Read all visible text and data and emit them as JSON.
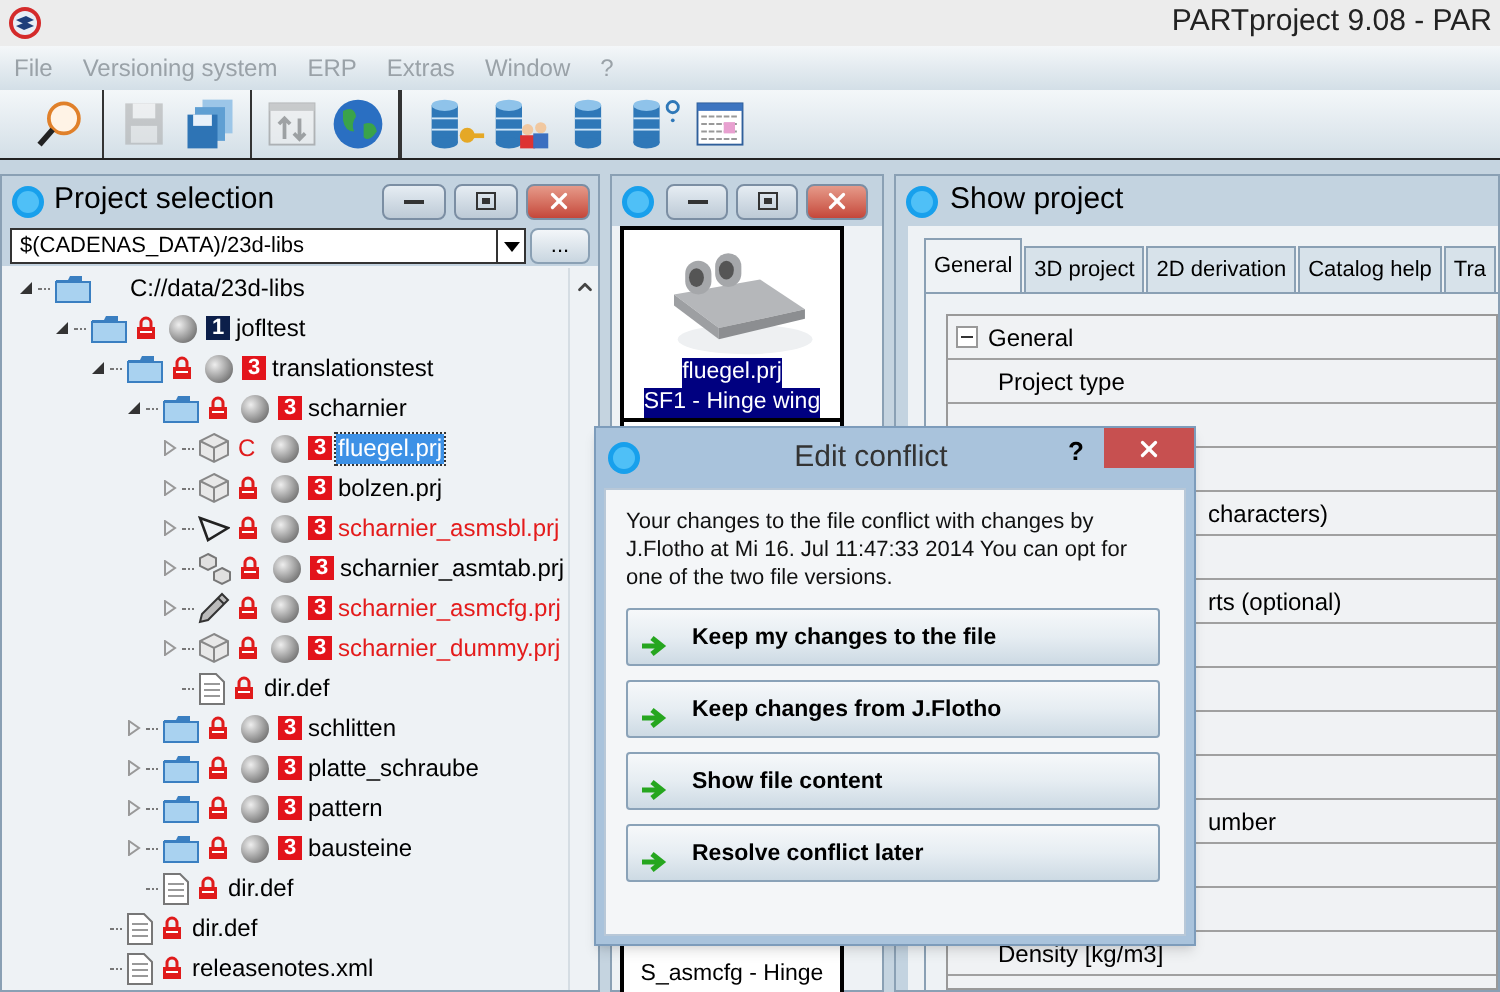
{
  "window": {
    "title": "PARTproject 9.08 - PAR"
  },
  "menu": [
    {
      "label": "File",
      "disabled": true
    },
    {
      "label": "Versioning system",
      "disabled": true
    },
    {
      "label": "ERP",
      "disabled": true
    },
    {
      "label": "Extras",
      "disabled": true
    },
    {
      "label": "Window",
      "disabled": true
    },
    {
      "label": "?",
      "disabled": true
    }
  ],
  "toolbar": {
    "groups": [
      [
        {
          "kind": "magnifier",
          "disabled": false
        }
      ],
      [
        {
          "kind": "save",
          "disabled": true
        },
        {
          "kind": "save-all",
          "disabled": false
        }
      ],
      [
        {
          "kind": "convert",
          "disabled": true
        },
        {
          "kind": "globe",
          "disabled": false
        }
      ],
      [
        {
          "kind": "db-key",
          "disabled": false
        },
        {
          "kind": "db-users",
          "disabled": false
        },
        {
          "kind": "db",
          "disabled": false
        },
        {
          "kind": "db-help",
          "disabled": false
        },
        {
          "kind": "table",
          "disabled": false
        }
      ]
    ]
  },
  "project_selection": {
    "title": "Project selection",
    "path": "$(CADENAS_DATA)/23d-libs",
    "browse_label": "...",
    "tree": [
      {
        "name": "C://data/23d-libs",
        "kind": "folder",
        "expanded": true,
        "selected": false,
        "modified": false,
        "children": [
          {
            "name": "jofltest",
            "kind": "folder",
            "expanded": true,
            "locked": true,
            "badge": "1",
            "color": "#0c1f4a",
            "selected": false,
            "modified": false,
            "children": [
              {
                "name": "translationstest",
                "kind": "folder",
                "expanded": true,
                "locked": true,
                "badge": "3",
                "color": "#e3141b",
                "selected": false,
                "modified": false,
                "children": [
                  {
                    "name": "scharnier",
                    "kind": "folder",
                    "expanded": true,
                    "locked": true,
                    "badge": "3",
                    "color": "#e3141b",
                    "selected": false,
                    "modified": false,
                    "children": [
                      {
                        "name": "fluegel.prj",
                        "kind": "part",
                        "expanded": false,
                        "status": "C",
                        "badge": "3",
                        "color": "#e3141b",
                        "selected": true
                      },
                      {
                        "name": "bolzen.prj",
                        "kind": "part",
                        "expanded": false,
                        "locked": true,
                        "badge": "3",
                        "color": "#e3141b",
                        "selected": false,
                        "modified": false
                      },
                      {
                        "name": "scharnier_asmsbl.prj",
                        "kind": "triangle",
                        "expanded": false,
                        "locked": true,
                        "badge": "3",
                        "color": "#e3141b",
                        "selected": false,
                        "modified": true
                      },
                      {
                        "name": "scharnier_asmtab.prj",
                        "kind": "parts",
                        "expanded": false,
                        "locked": true,
                        "badge": "3",
                        "color": "#e3141b",
                        "selected": false,
                        "modified": false
                      },
                      {
                        "name": "scharnier_asmcfg.prj",
                        "kind": "pencil",
                        "expanded": false,
                        "locked": true,
                        "badge": "3",
                        "color": "#e3141b",
                        "selected": false,
                        "modified": true
                      },
                      {
                        "name": "scharnier_dummy.prj",
                        "kind": "part",
                        "expanded": false,
                        "locked": true,
                        "badge": "3",
                        "color": "#e3141b",
                        "selected": false,
                        "modified": true
                      },
                      {
                        "name": "dir.def",
                        "kind": "file",
                        "locked": true,
                        "selected": false,
                        "modified": false
                      }
                    ]
                  },
                  {
                    "name": "schlitten",
                    "kind": "folder",
                    "expanded": false,
                    "locked": true,
                    "badge": "3",
                    "color": "#e3141b",
                    "selected": false,
                    "modified": false
                  },
                  {
                    "name": "platte_schraube",
                    "kind": "folder",
                    "expanded": false,
                    "locked": true,
                    "badge": "3",
                    "color": "#e3141b",
                    "selected": false,
                    "modified": false
                  },
                  {
                    "name": "pattern",
                    "kind": "folder",
                    "expanded": false,
                    "locked": true,
                    "badge": "3",
                    "color": "#e3141b",
                    "selected": false,
                    "modified": false
                  },
                  {
                    "name": "bausteine",
                    "kind": "folder",
                    "expanded": false,
                    "locked": true,
                    "badge": "3",
                    "color": "#e3141b",
                    "selected": false,
                    "modified": false
                  },
                  {
                    "name": "dir.def",
                    "kind": "file",
                    "locked": true,
                    "selected": false,
                    "modified": false
                  }
                ]
              },
              {
                "name": "dir.def",
                "kind": "file",
                "locked": true,
                "selected": false,
                "modified": false
              },
              {
                "name": "releasenotes.xml",
                "kind": "file",
                "locked": true,
                "selected": false,
                "modified": false
              }
            ]
          }
        ]
      }
    ]
  },
  "preview": {
    "cards": [
      {
        "kind": "picture",
        "file": "fluegel.prj",
        "caption": "SF1 - Hinge wing",
        "selected": true
      },
      {
        "kind": "covered",
        "caption": "S_asmcfg - Hinge",
        "selected": false
      }
    ]
  },
  "show_project": {
    "title": "Show project",
    "tabs": [
      {
        "label": "General",
        "selected": true
      },
      {
        "label": "3D project",
        "selected": false
      },
      {
        "label": "2D derivation",
        "selected": false
      },
      {
        "label": "Catalog help",
        "selected": false
      },
      {
        "label": "Tra",
        "selected": false
      }
    ],
    "group": {
      "label": "General",
      "expanded": true
    },
    "rows": [
      {
        "kind": "full",
        "label": "Project type"
      },
      {
        "kind": "blank"
      },
      {
        "kind": "blank"
      },
      {
        "kind": "clipped",
        "label": "characters)"
      },
      {
        "kind": "blank"
      },
      {
        "kind": "clipped",
        "label": "rts (optional)"
      },
      {
        "kind": "blank"
      },
      {
        "kind": "blank"
      },
      {
        "kind": "blank"
      },
      {
        "kind": "blank"
      },
      {
        "kind": "clipped",
        "label": "umber"
      },
      {
        "kind": "blank"
      },
      {
        "kind": "blank"
      },
      {
        "kind": "full",
        "label": "Density [kg/m3]"
      },
      {
        "kind": "blank"
      }
    ]
  },
  "dialog": {
    "title": "Edit conflict",
    "help": "?",
    "message": "Your changes to the file conflict with changes by J.Flotho at Mi 16. Jul 11:47:33 2014 You can opt for one of the two file versions.",
    "buttons": [
      "Keep my changes to the file",
      "Keep changes from J.Flotho",
      "Show file content",
      "Resolve conflict later"
    ]
  }
}
